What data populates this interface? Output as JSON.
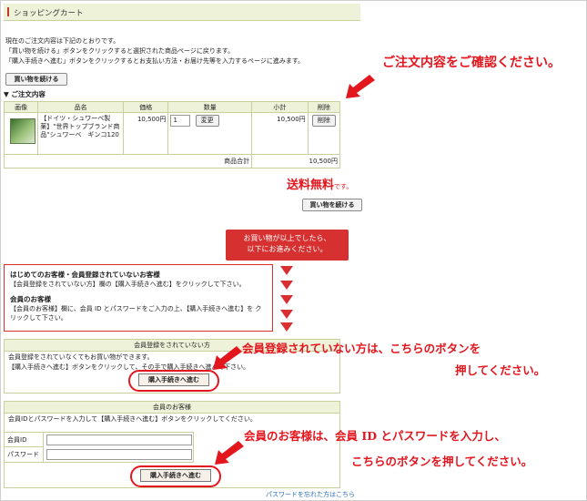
{
  "title": "ショッピングカート",
  "intro": [
    "現在のご注文内容は下記のとおりです。",
    "「買い物を続ける」ボタンをクリックすると選択された商品ページに戻ります。",
    "「購入手続きへ進む」ボタンをクリックするとお支払い方法・お届け先等を入力するページに進みます。"
  ],
  "continue_button": "買い物を続ける",
  "order_heading": "▼ ご注文内容",
  "table": {
    "headers": [
      "画像",
      "品名",
      "価格",
      "数量",
      "小計",
      "削除"
    ],
    "row": {
      "name": "【ドイツ・シュワーベ製薬】\"世界トップブランド商品\"シュワーベ　ギンコ120",
      "price": "10,500円",
      "quantity": "1",
      "update_label": "変更",
      "subtotal": "10,500円",
      "delete_label": "削除"
    },
    "total_label": "商品合計",
    "total_value": "10,500円"
  },
  "callout_confirm": "ご注文内容をご確認ください。",
  "free_shipping": "送料無料",
  "free_shipping_suffix": "です。",
  "continue_button_2": "買い物を続ける",
  "redbox": [
    "お買い物が以上でしたら、",
    "以下にお進みください。"
  ],
  "info": {
    "guest_heading": "はじめてのお客様・会員登録されていないお客様",
    "guest_text": "【会員登録をされていない方】欄の【購入手続きへ進む】をクリックして下さい。",
    "member_heading": "会員のお客様",
    "member_text": "【会員のお客様】欄に、会員 ID とパスワードをご入力の上、【購入手続きへ進む】を クリックして下さい。"
  },
  "guest_panel": {
    "header": "会員登録をされていない方",
    "line1": "会員登録をされていなくてもお買い物ができます。",
    "line2": "【購入手続きへ進む】ボタンをクリックして、その手で購入手続きへ進んで下さい。",
    "button": "購入手続きへ進む"
  },
  "callout_guest": [
    "会員登録されていない方は、こちらのボタンを",
    "押してください。"
  ],
  "member_panel": {
    "header": "会員のお客様",
    "line1": "会員IDとパスワードを入力して【購入手続きへ進む】ボタンをクリックしてください。",
    "id_label": "会員ID",
    "password_label": "パスワード",
    "button": "購入手続きへ進む"
  },
  "callout_member": [
    "会員のお客様は、会員 ID とパスワードを入力し、",
    "こちらのボタンを押してください。"
  ],
  "forgot_link": "パスワードを忘れた方はこちら"
}
